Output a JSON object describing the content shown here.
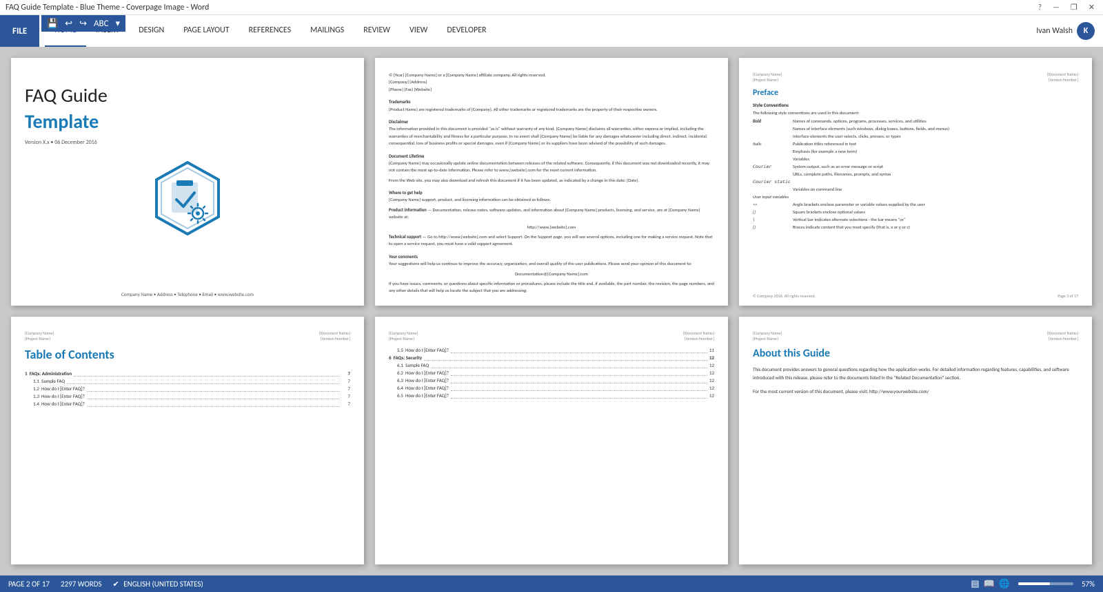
{
  "titleBar": {
    "title": "FAQ Guide Template - Blue Theme - Coverpage Image - Word",
    "controls": [
      "?",
      "—",
      "❐",
      "✕"
    ]
  },
  "ribbon": {
    "fileTab": "FILE",
    "tabs": [
      "HOME",
      "INSERT",
      "DESIGN",
      "PAGE LAYOUT",
      "REFERENCES",
      "MAILINGS",
      "REVIEW",
      "VIEW",
      "DEVELOPER"
    ],
    "activeTab": "HOME",
    "user": {
      "name": "Ivan Walsh",
      "initial": "K"
    }
  },
  "qat": {
    "buttons": [
      "💾",
      "📋",
      "↩",
      "↪",
      "ABC",
      "✔",
      "↗"
    ]
  },
  "pages": {
    "cover": {
      "titleMain": "FAQ Guide",
      "titleSub": "Template",
      "version": "Version X.x  •  06 December 2016",
      "footer": "Company Name  •  Address  •  Telephone  •  Email  •  www.website.com"
    },
    "copyright": {
      "line1": "© [Year] [Company Name] or a [Company Name] affiliate company. All rights reserved.",
      "line2": "[Company] [Address]",
      "line3": "[Phone] [Fax] [Website]",
      "sections": [
        {
          "heading": "Trademarks",
          "text": "[Product Name] are registered trademarks of [Company]. All other trademarks or registered trademarks are the property of their respective owners."
        },
        {
          "heading": "Disclaimer",
          "text": "The information provided in this document is provided \"as is\" without warranty of any kind. [Company Name] disclaims all warranties, either express or implied, including the warranties of merchantability and fitness for a particular purpose. In no event shall [Company Name] be liable for any damages whatsoever including direct, indirect, incidental, consequential, loss of business profits or special damages, even if [Company Name] or its suppliers have been advised of the possibility of such damages."
        },
        {
          "heading": "Document Lifetime",
          "text": "[Company Name] may occasionally update online documentation between releases of the related software. Consequently, if this document was not downloaded recently, it may not contain the most up-to-date information. Please refer to www.[website].com for the most current information.\n\nFrom the Web site, you may also download and refresh this document if it has been updated, as indicated by a change in this date: [Date]."
        },
        {
          "heading": "Where to get help",
          "text": "[Company Name] support, product, and licensing information can be obtained as follows."
        },
        {
          "heading": "Product Information",
          "text": "— Documentation, release notes, software updates, and information about [Company Name] products, licensing, and service, are at [Company Name] website at:\n\nhttp://www.[website].com"
        },
        {
          "heading": "Technical support",
          "text": "— Go to http://www.[website].com and select Support. On the Support page, you will see several options, including one for making a service request. Note that to open a service request, you must have a valid support agreement."
        },
        {
          "heading": "Your comments",
          "text": "Your suggestions will help us continue to improve the accuracy, organization, and overall quality of the user publications. Please send your opinion of this document to:\n\nDocumentation@[Company Name].com\n\nIf you have issues, comments, or questions about specific information or procedures, please include the title and, if available, the part number, the revision, the page numbers, and any other details that will help us locate the subject that you are addressing."
        }
      ]
    },
    "preface": {
      "headerLeft1": "[Company Name]",
      "headerLeft2": "[Project Name]",
      "headerRight1": "[Document Name]",
      "headerRight2": "[Version Number]",
      "title": "Preface",
      "styleConventionsTitle": "Style Conventions",
      "styleConventionsIntro": "The following style conventions are used in this document:",
      "conventions": [
        {
          "label": "Bold",
          "desc": "Names of commands, options, programs, processes, services, and utilities"
        },
        {
          "label": "",
          "desc": "Names of interface elements (such windows, dialog boxes, buttons, fields, and menus)"
        },
        {
          "label": "",
          "desc": "Interface elements the user selects, clicks, presses, or types"
        },
        {
          "label": "Italic",
          "desc": "Publication titles referenced in text"
        },
        {
          "label": "",
          "desc": "Emphasis (for example a new term)"
        },
        {
          "label": "",
          "desc": "Variables"
        },
        {
          "label": "Courier",
          "desc": "System output, such as an error message or script"
        },
        {
          "label": "",
          "desc": "URLs, complete paths, filenames, prompts, and syntax"
        },
        {
          "label": "Courier static",
          "desc": ""
        },
        {
          "label": "",
          "desc": "Variables on command line"
        },
        {
          "label": "User input variables",
          "desc": ""
        },
        {
          "label": "<>",
          "desc": "Angle brackets enclose parameter or variable values supplied by the user"
        },
        {
          "label": "[]",
          "desc": "Square brackets enclose optional values"
        },
        {
          "label": "|",
          "desc": "Vertical bar indicates alternate selections - the bar means \"or\""
        },
        {
          "label": "{}",
          "desc": "Braces indicate content that you must specify (that is, x or y or z)"
        }
      ],
      "footer": "© Company 2016. All rights reserved.",
      "footerPage": "Page 3 of 17"
    },
    "toc": {
      "headerLeft1": "[Company Name]",
      "headerLeft2": "[Project Name]",
      "headerRight1": "[Document Name]",
      "headerRight2": "[Version Number]",
      "title": "Table of Contents",
      "entries": [
        {
          "num": "1",
          "label": "FAQs: Administration",
          "page": "7",
          "level": 0
        },
        {
          "num": "1.1",
          "label": "Sample FAQ",
          "page": "7",
          "level": 1
        },
        {
          "num": "1.2",
          "label": "How do I [Enter FAQ]?",
          "page": "7",
          "level": 1
        },
        {
          "num": "1.3",
          "label": "How do I [Enter FAQ]?",
          "page": "7",
          "level": 1
        },
        {
          "num": "1.4",
          "label": "How do I [Enter FAQ]?",
          "page": "7",
          "level": 1
        }
      ]
    },
    "faqSecurity": {
      "headerLeft1": "[Company Name]",
      "headerLeft2": "[Project Name]",
      "headerRight1": "[Document Name]",
      "headerRight2": "[Version Number]",
      "entries": [
        {
          "num": "5.5",
          "label": "How do I [Enter FAQ]?",
          "page": "11",
          "level": 1
        },
        {
          "num": "6",
          "label": "FAQs: Security",
          "page": "12",
          "level": 0
        },
        {
          "num": "6.1",
          "label": "Sample FAQ",
          "page": "12",
          "level": 1
        },
        {
          "num": "6.2",
          "label": "How do I [Enter FAQ]?",
          "page": "12",
          "level": 1
        },
        {
          "num": "6.3",
          "label": "How do I [Enter FAQ]?",
          "page": "12",
          "level": 1
        },
        {
          "num": "6.4",
          "label": "How do I [Enter FAQ]?",
          "page": "12",
          "level": 1
        },
        {
          "num": "6.5",
          "label": "How do I [Enter FAQ]?",
          "page": "12",
          "level": 1
        }
      ]
    },
    "about": {
      "headerLeft1": "[Company Name]",
      "headerLeft2": "[Project Name]",
      "headerRight1": "[Document Name]",
      "headerRight2": "[Version Number]",
      "title": "About this Guide",
      "text1": "This document provides answers to general questions regarding how the application works. For detailed information regarding features, capabilities, and software introduced with this release, please refer to the documents listed in the \"Related Documentation\" section.",
      "text2": "For the most current version of this document, please visit: http://www.yourwebsite.com/"
    }
  },
  "statusBar": {
    "page": "PAGE 2 OF 17",
    "words": "2297 WORDS",
    "language": "ENGLISH (UNITED STATES)",
    "zoom": "57%",
    "zoomPercent": 57
  }
}
